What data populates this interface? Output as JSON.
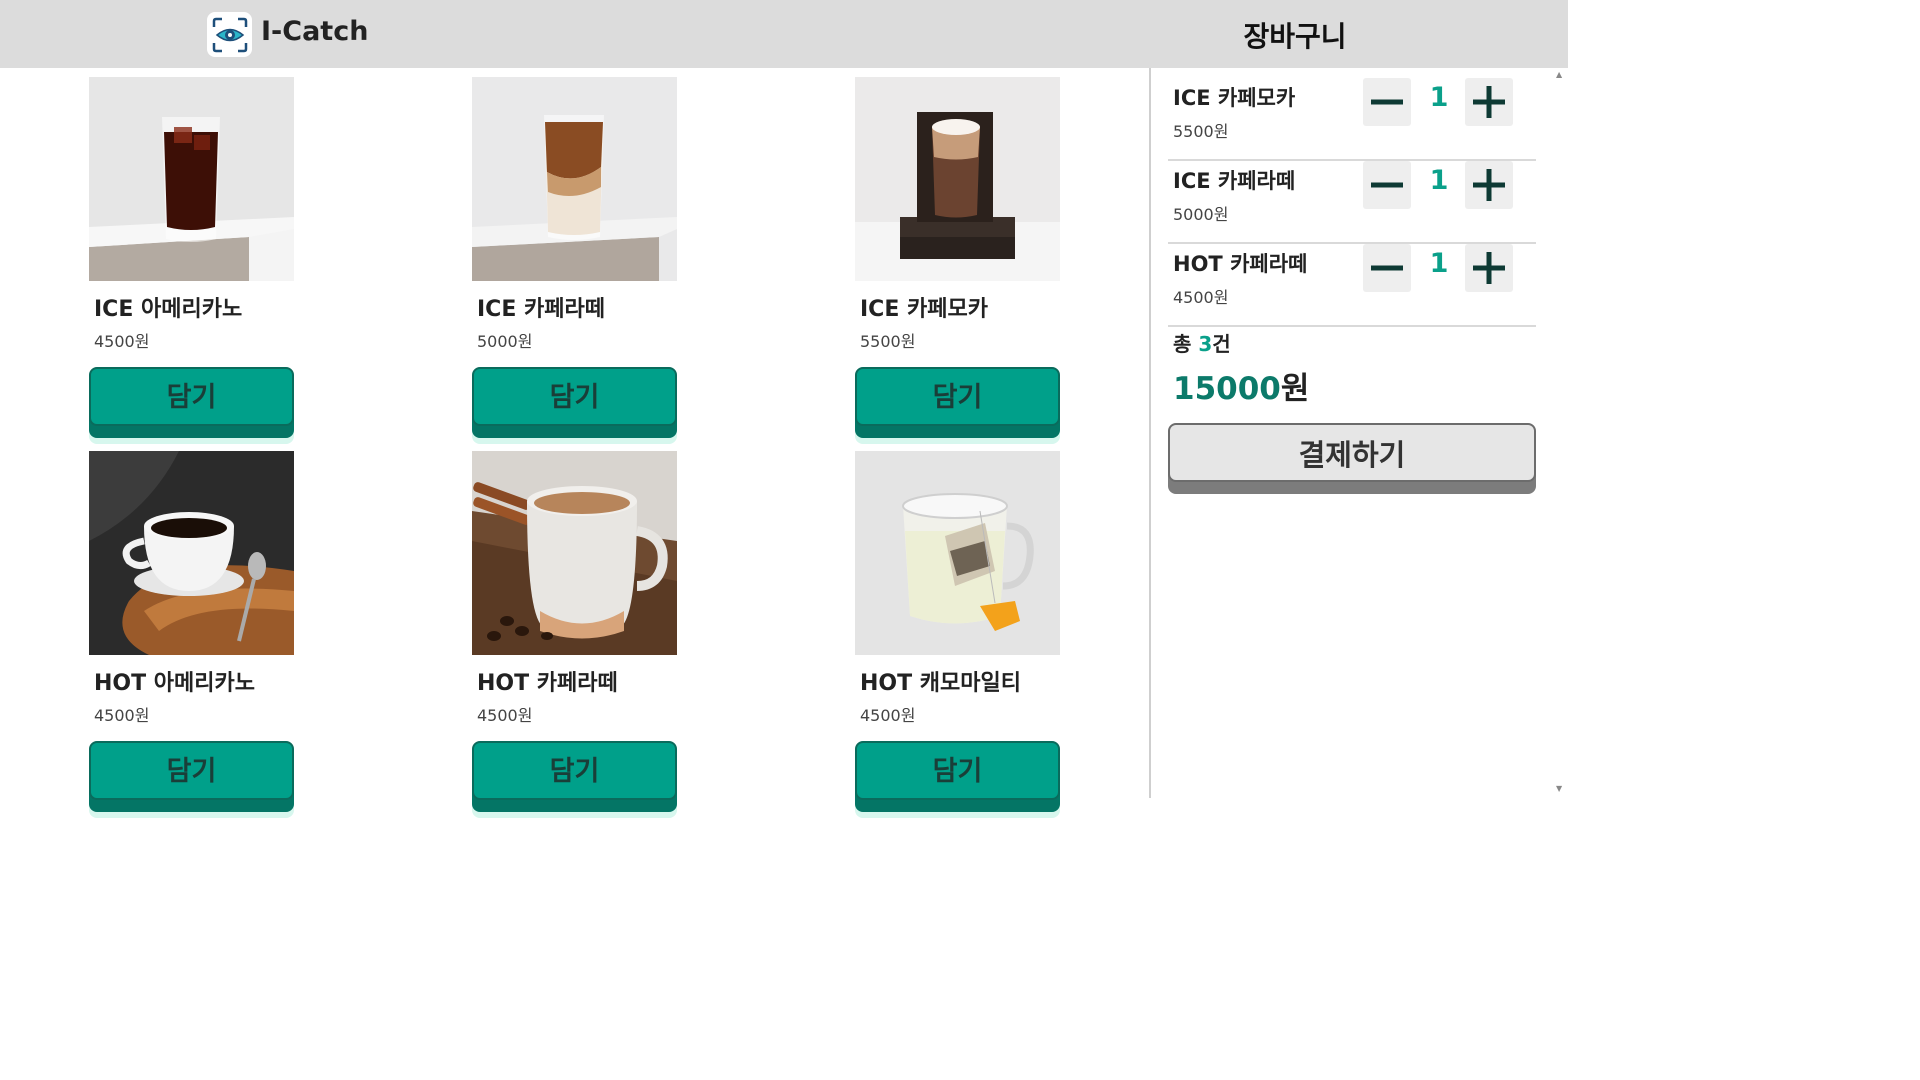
{
  "header": {
    "brand": "I-Catch",
    "cart_title": "장바구니"
  },
  "menu": {
    "items": [
      {
        "name": "ICE 아메리카노",
        "price": "4500원",
        "add_label": "담기"
      },
      {
        "name": "ICE 카페라떼",
        "price": "5000원",
        "add_label": "담기"
      },
      {
        "name": "ICE 카페모카",
        "price": "5500원",
        "add_label": "담기"
      },
      {
        "name": "HOT 아메리카노",
        "price": "4500원",
        "add_label": "담기"
      },
      {
        "name": "HOT 카페라떼",
        "price": "4500원",
        "add_label": "담기"
      },
      {
        "name": "HOT 캐모마일티",
        "price": "4500원",
        "add_label": "담기"
      }
    ]
  },
  "cart": {
    "items": [
      {
        "name": "ICE 카페모카",
        "price": "5500원",
        "qty": "1"
      },
      {
        "name": "ICE 카페라떼",
        "price": "5000원",
        "qty": "1"
      },
      {
        "name": "HOT 카페라떼",
        "price": "4500원",
        "qty": "1"
      }
    ],
    "total_prefix": "총",
    "total_count": "3",
    "total_suffix": "건",
    "total_amount": "15000",
    "total_unit": "원",
    "pay_label": "결제하기"
  },
  "colors": {
    "accent": "#00a08a",
    "accent_dark": "#047565",
    "header_bg": "#dcdcdc"
  }
}
